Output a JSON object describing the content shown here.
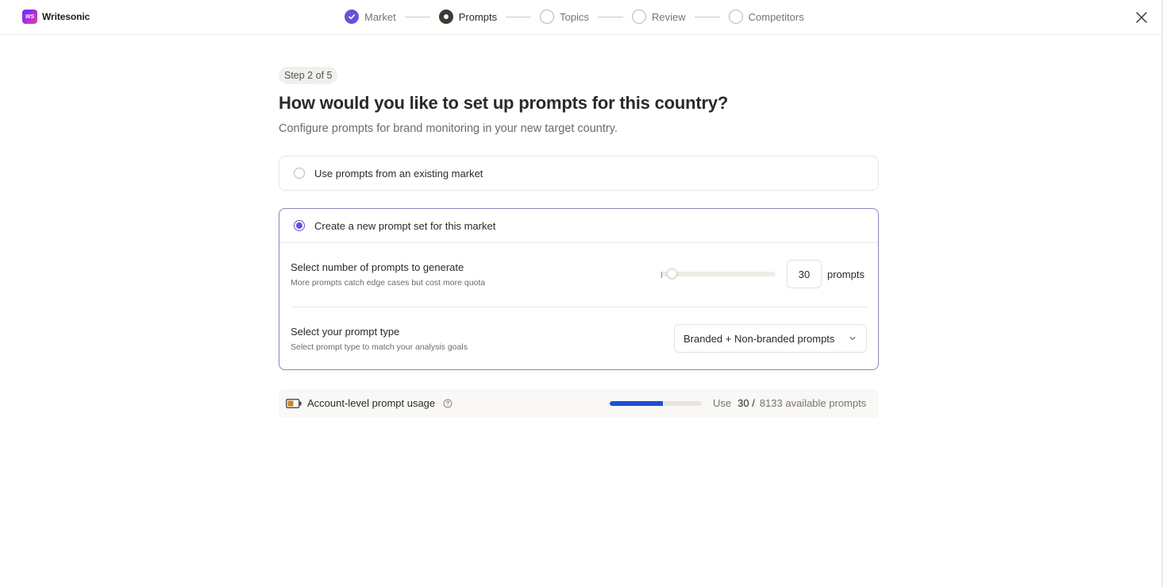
{
  "app": {
    "logo_text": "Writesonic",
    "logo_mark": "WS"
  },
  "stepper": {
    "steps": [
      {
        "label": "Market",
        "state": "done"
      },
      {
        "label": "Prompts",
        "state": "current"
      },
      {
        "label": "Topics",
        "state": "pending"
      },
      {
        "label": "Review",
        "state": "pending"
      },
      {
        "label": "Competitors",
        "state": "pending"
      }
    ]
  },
  "main": {
    "step_badge": "Step 2 of 5",
    "title": "How would you like to set up prompts for this country?",
    "subtitle": "Configure prompts for brand monitoring in your new target country."
  },
  "options": {
    "existing": {
      "label": "Use prompts from an existing market",
      "selected": false
    },
    "new": {
      "label": "Create a new prompt set for this market",
      "selected": true,
      "count_setting": {
        "title": "Select number of prompts to generate",
        "description": "More prompts catch edge cases but cost more quota",
        "value": "30",
        "unit": "prompts",
        "slider_fraction": 0.05
      },
      "type_setting": {
        "title": "Select your prompt type",
        "description": "Select prompt type to match your analysis goals",
        "selected": "Branded + Non-branded prompts"
      }
    }
  },
  "usage": {
    "label": "Account-level prompt usage",
    "use_prefix": "Use",
    "used": "30 /",
    "available": "8133 available prompts",
    "bar_fraction": 0.58
  },
  "colors": {
    "accent": "#6b4fd8",
    "usage_bar": "#1c4fd6",
    "battery": "#c98a1e"
  },
  "icons": {
    "close": "close-icon",
    "check": "check-icon",
    "chevron": "chevron-down-icon",
    "help": "help-circle-icon",
    "battery": "battery-icon"
  }
}
